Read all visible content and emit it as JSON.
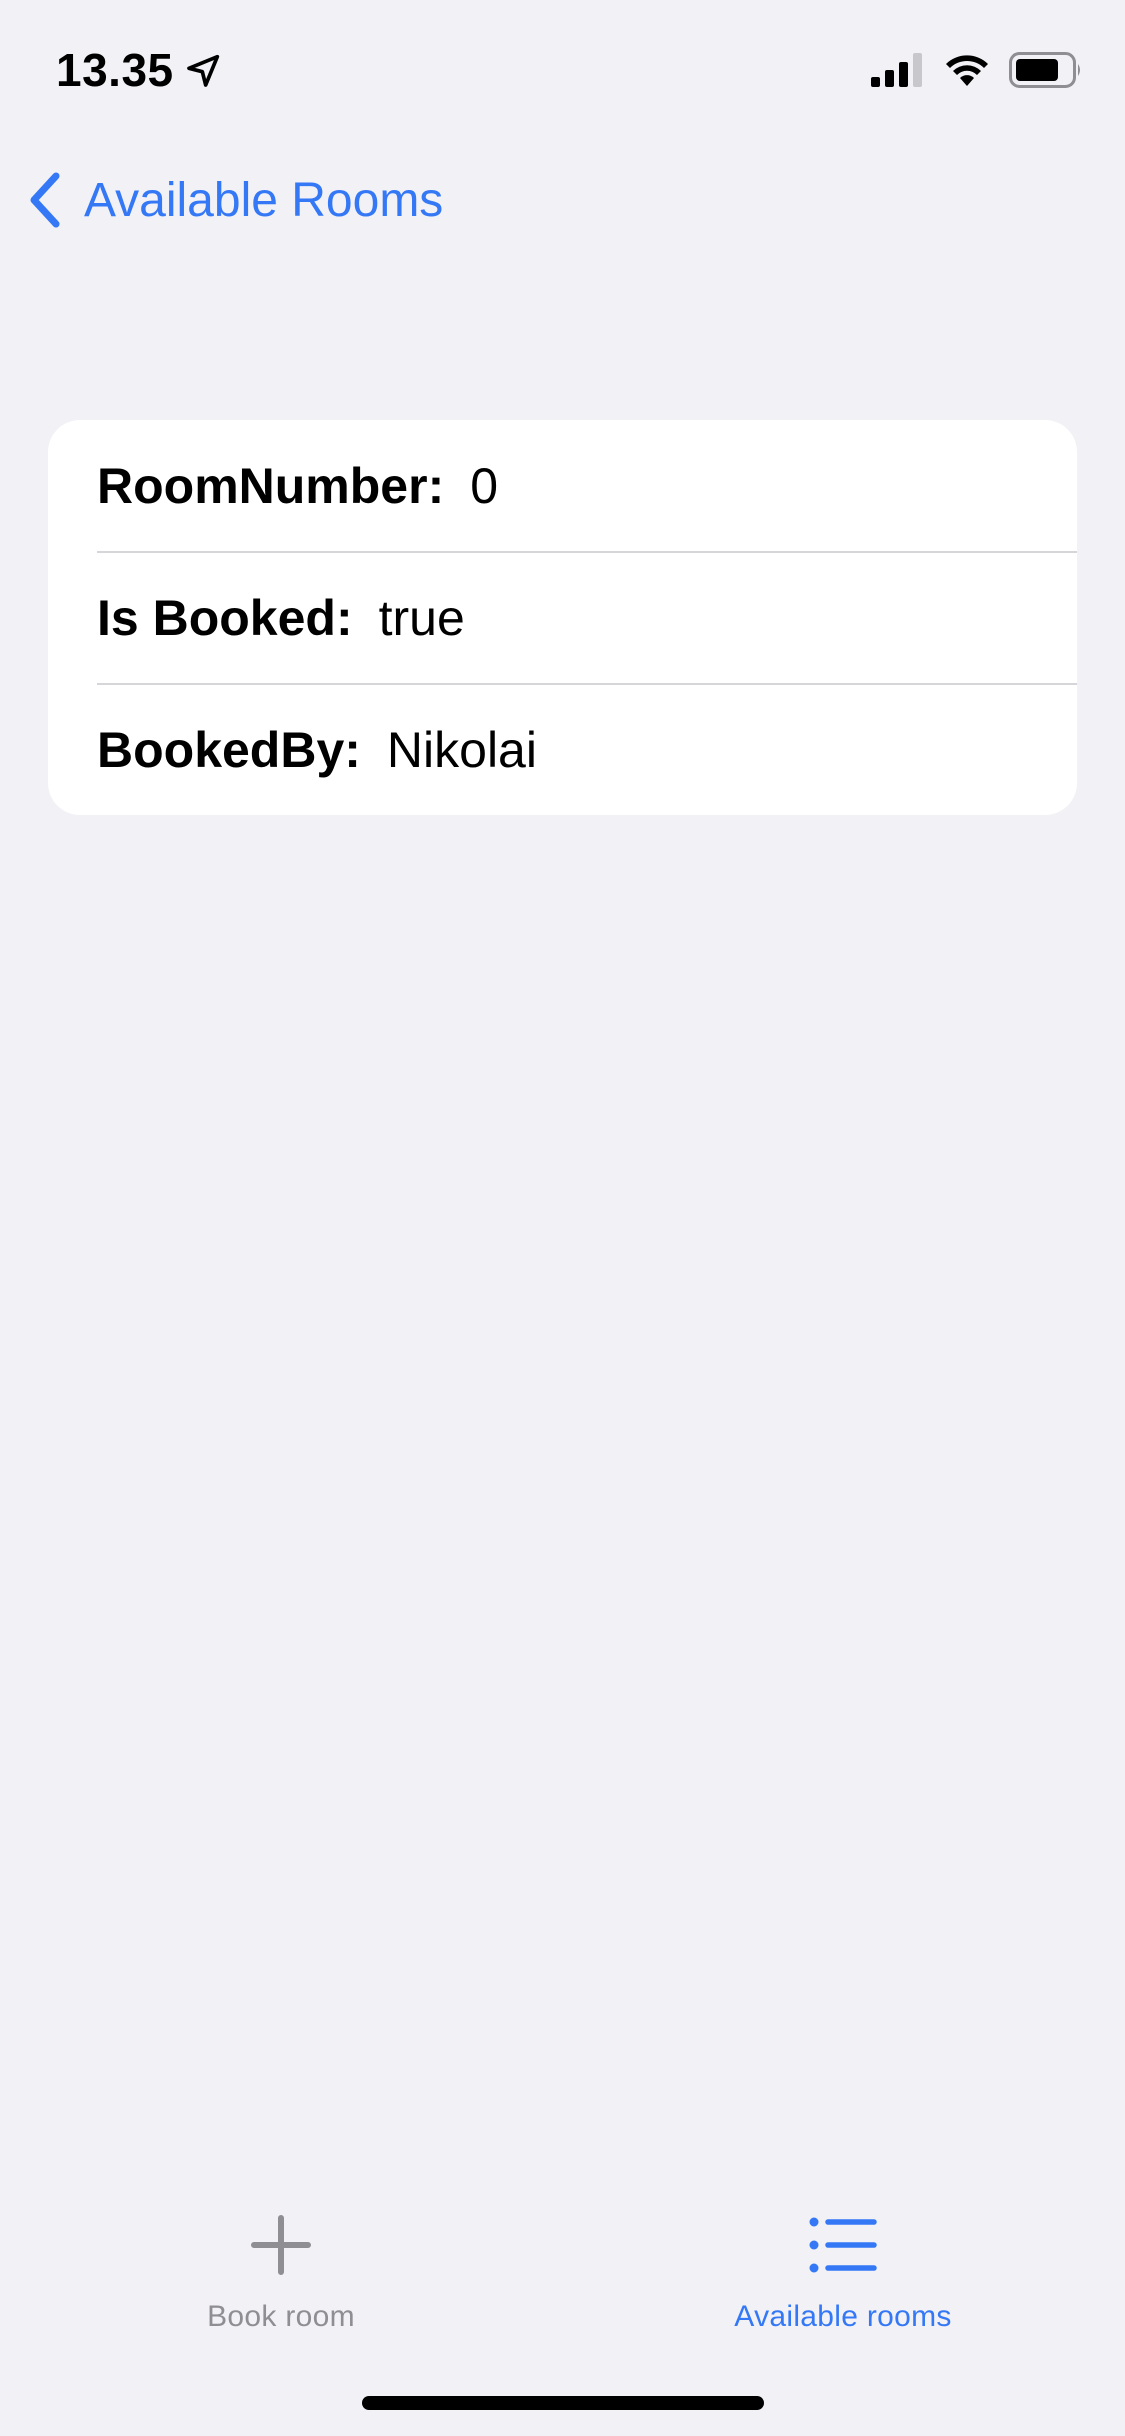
{
  "status_bar": {
    "time": "13.35",
    "location_icon": "location-arrow-icon",
    "signal_icon": "cellular-signal-icon",
    "wifi_icon": "wifi-icon",
    "battery_icon": "battery-icon"
  },
  "nav": {
    "back_label": "Available Rooms",
    "back_icon": "chevron-left-icon"
  },
  "room_details": {
    "rows": [
      {
        "label": "RoomNumber:",
        "value": "0"
      },
      {
        "label": "Is Booked:",
        "value": "true"
      },
      {
        "label": "BookedBy:",
        "value": "Nikolai"
      }
    ]
  },
  "tab_bar": {
    "tabs": [
      {
        "label": "Book room",
        "icon": "plus-icon",
        "selected": false
      },
      {
        "label": "Available rooms",
        "icon": "list-icon",
        "selected": true
      }
    ]
  },
  "colors": {
    "accent": "#3478f6",
    "background": "#f1f1f6",
    "card": "#ffffff",
    "inactive_tab": "#8e8e93"
  }
}
